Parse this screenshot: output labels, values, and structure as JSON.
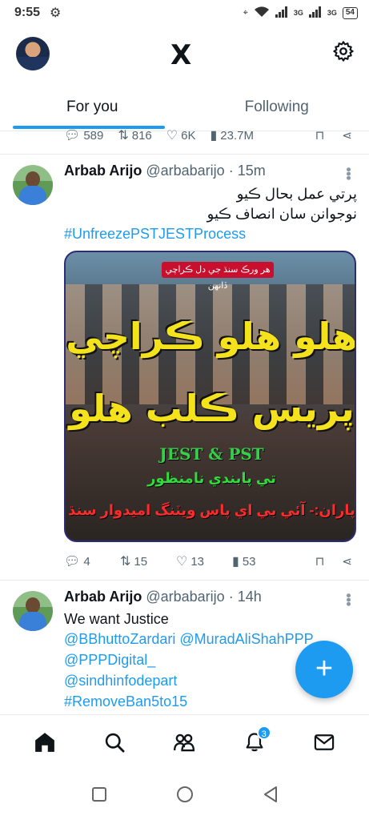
{
  "status_bar": {
    "time": "9:55",
    "network": "3G",
    "network2": "3G",
    "battery": "54"
  },
  "header": {
    "logo": "X",
    "tabs": [
      {
        "label": "For you",
        "active": true
      },
      {
        "label": "Following",
        "active": false
      }
    ]
  },
  "previous_tweet_actions": {
    "replies": "589",
    "reposts": "816",
    "likes": "6K",
    "views": "23.7M"
  },
  "tweets": [
    {
      "name": "Arbab Arijo",
      "handle": "@arbabarijo",
      "time": "· 15m",
      "text_line1": "پرتي عمل بحال ڪيو",
      "text_line2": "نوجوانن سان انصاف ڪيو",
      "hashtag": "#UnfreezePSTJESTProcess",
      "media": {
        "banner": "هر ورڪ سنڌ جي دل ڪراچي ڏانهن",
        "line1": "هلو هلو ڪراچي",
        "line2": "پريس ڪلب هلو",
        "line3": "JEST & PST",
        "line4": "تي پابندي نامنظور",
        "line5": "پاران:- آئي بي اي پاس ويٽنگ اميدوار سنڌ"
      },
      "replies": "4",
      "reposts": "15",
      "likes": "13",
      "views": "53"
    },
    {
      "name": "Arbab Arijo",
      "handle": "@arbabarijo",
      "time": "· 14h",
      "text_line1": "We want Justice",
      "mention1": "@BBhuttoZardari @MuradAliShahPPP",
      "mention2": "@PPPDigital_",
      "mention3": "@sindhinfodepart",
      "hashtag": "#RemoveBan5to15"
    }
  ],
  "fab": {
    "label": "+"
  },
  "bottom_nav": {
    "notifications_badge": "3"
  },
  "colors": {
    "accent": "#1d9bf0",
    "text": "#0f1419",
    "muted": "#536471"
  }
}
